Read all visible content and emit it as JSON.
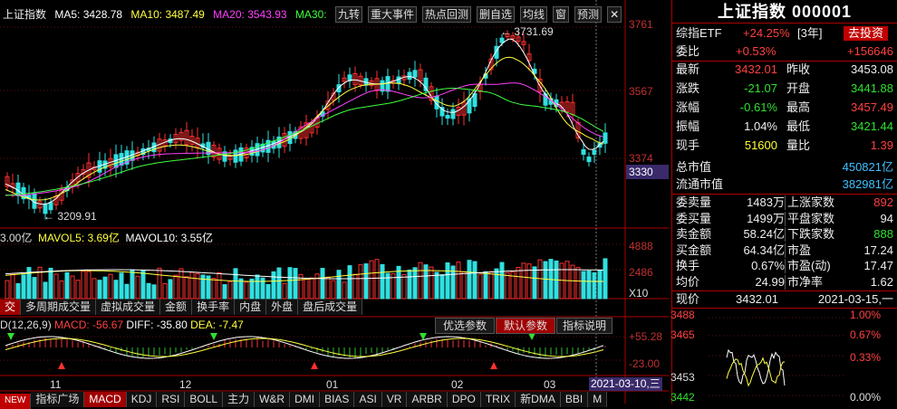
{
  "index_bar": {
    "name": "上证指数",
    "ma5": "MA5: 3428.78",
    "ma10": "MA10: 3487.49",
    "ma20": "MA20: 3543.93",
    "ma30": "MA30:",
    "buttons": [
      "九转",
      "重大事件",
      "热点回测",
      "删自选",
      "均线",
      "窗",
      "预测"
    ]
  },
  "price_axis": [
    "3761",
    "3567",
    "3374",
    "3330"
  ],
  "annotations": {
    "high": "3731.69",
    "low": "3209.91"
  },
  "vol_legend": {
    "vol": "3.00亿",
    "mavol5": "MAVOL5: 3.69亿",
    "mavol10": "MAVOL10: 3.55亿"
  },
  "vol_axis": [
    "4888",
    "2486",
    "X10"
  ],
  "mid_tabs": [
    "交",
    "多周期成交量",
    "虚拟成交量",
    "金额",
    "换手率",
    "内盘",
    "外盘",
    "盘后成交量"
  ],
  "macd_legend": {
    "name": "D(12,26,9)",
    "macd": "MACD: -56.67",
    "diff": "DIFF: -35.80",
    "dea": "DEA: -7.47"
  },
  "macd_buttons": [
    "优选参数",
    "默认参数",
    "指标说明"
  ],
  "macd_axis": [
    "+55.28",
    "-23.00"
  ],
  "x_axis": [
    "11",
    "12",
    "01",
    "02",
    "03"
  ],
  "cursor_date": "2021-03-10,三",
  "bottom_tabs": [
    "NEW",
    "指标广场",
    "MACD",
    "KDJ",
    "RSI",
    "BOLL",
    "主力",
    "W&R",
    "DMI",
    "BIAS",
    "ASI",
    "VR",
    "ARBR",
    "DPO",
    "TRIX",
    "新DMA",
    "BBI",
    "M"
  ],
  "panel": {
    "title": "上证指数 000001",
    "etf_label": "综指ETF",
    "etf_change": "+24.25%",
    "etf_period": "[3年]",
    "etf_btn": "去投资",
    "weibi_label": "委比",
    "weibi": "+0.53%",
    "weicha": "+156646",
    "rows": [
      {
        "l": "最新",
        "v": "3432.01",
        "l2": "昨收",
        "v2": "3453.08",
        "c": "red",
        "c2": "white"
      },
      {
        "l": "涨跌",
        "v": "-21.07",
        "l2": "开盘",
        "v2": "3441.88",
        "c": "green",
        "c2": "green"
      },
      {
        "l": "涨幅",
        "v": "-0.61%",
        "l2": "最高",
        "v2": "3457.49",
        "c": "green",
        "c2": "red"
      },
      {
        "l": "振幅",
        "v": "1.04%",
        "l2": "最低",
        "v2": "3421.44",
        "c": "white",
        "c2": "green"
      },
      {
        "l": "现手",
        "v": "51600",
        "l2": "量比",
        "v2": "1.39",
        "c": "yel",
        "c2": "red"
      }
    ],
    "zong_label": "总市值",
    "zong": "450821亿",
    "liu_label": "流通市值",
    "liu": "382981亿",
    "stats": [
      {
        "l": "委卖量",
        "v": "1483万",
        "l2": "上涨家数",
        "v2": "892",
        "c2": "red"
      },
      {
        "l": "委买量",
        "v": "1499万",
        "l2": "平盘家数",
        "v2": "94",
        "c2": "white"
      },
      {
        "l": "卖金额",
        "v": "58.24亿",
        "l2": "下跌家数",
        "v2": "888",
        "c2": "green"
      },
      {
        "l": "买金额",
        "v": "64.34亿",
        "l2": "市盈",
        "v2": "17.24",
        "c2": "white"
      },
      {
        "l": "换手",
        "v": "0.67%",
        "l2": "市盈(动)",
        "v2": "17.47",
        "c2": "white"
      },
      {
        "l": "均价",
        "v": "24.99",
        "l2": "市净率",
        "v2": "1.62",
        "c2": "white"
      }
    ],
    "now_label": "现价",
    "now": "3432.01",
    "now_date": "2021-03-15,一",
    "mini_left": [
      "3488",
      "3465",
      "3453",
      "3442"
    ],
    "mini_right": [
      "1.00%",
      "0.67%",
      "0.33%",
      "0.00%"
    ]
  },
  "colors": {
    "up": "#ff3030",
    "down": "#30e0e0",
    "ma5": "#ffffff",
    "ma10": "#ffff40",
    "ma20": "#ff40ff",
    "ma30": "#40ff40"
  }
}
